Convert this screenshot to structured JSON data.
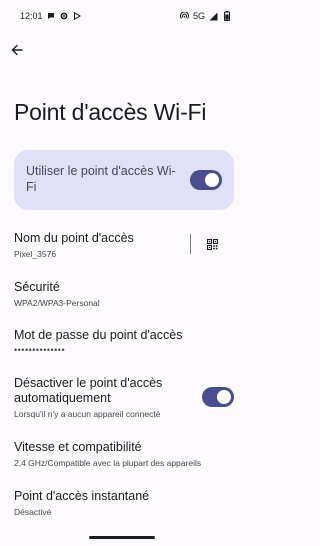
{
  "status_bar": {
    "time": "12:01",
    "network": "5G",
    "left_icons": [
      "chat-bubble-icon",
      "gear-icon",
      "play-store-icon"
    ],
    "right_icons": [
      "hotspot-icon",
      "signal-icon",
      "battery-icon"
    ]
  },
  "page": {
    "title": "Point d'accès Wi-Fi"
  },
  "main_toggle": {
    "label": "Utiliser le point d'accès Wi-Fi",
    "enabled": true
  },
  "settings": {
    "hotspot_name": {
      "title": "Nom du point d'accès",
      "value": "Pixel_3576"
    },
    "security": {
      "title": "Sécurité",
      "value": "WPA2/WPA3-Personal"
    },
    "password": {
      "title": "Mot de passe du point d'accès",
      "value": "••••••••••••••"
    },
    "auto_off": {
      "title_line1": "Désactiver le point d'accès",
      "title_line2": "automatiquement",
      "subtitle": "Lorsqu'il n'y a aucun appareil connecté",
      "enabled": true
    },
    "speed": {
      "title": "Vitesse et compatibilité",
      "value": "2,4 GHz/Compatible avec la plupart des appareils"
    },
    "instant_hotspot": {
      "title": "Point d'accès instantané",
      "value": "Désactivé"
    }
  },
  "colors": {
    "background": "#fdfbff",
    "card": "#e1e0f9",
    "toggle_track": "#4a4e8e",
    "text_primary": "#1b1b1f",
    "text_secondary": "#45464f"
  }
}
